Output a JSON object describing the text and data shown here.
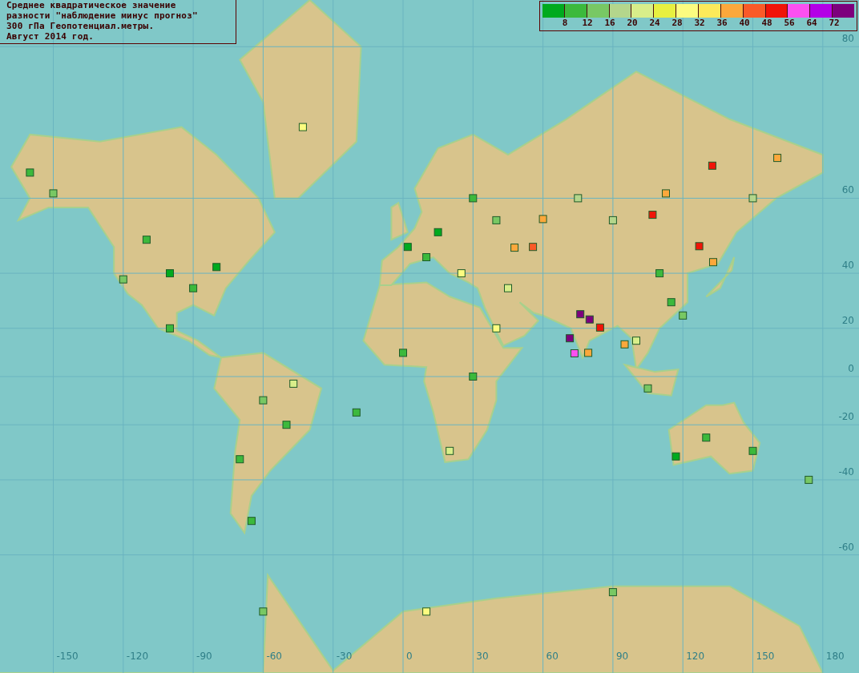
{
  "title_lines": [
    "Среднее квадратическое значение",
    "разности \"наблюдение минус прогноз\"",
    "300 гПа Геопотенциал.метры.",
    "Август 2014 год."
  ],
  "legend": {
    "swatches": [
      {
        "color": "#00aa1e"
      },
      {
        "color": "#3cb93c"
      },
      {
        "color": "#78c864"
      },
      {
        "color": "#b4d68c"
      },
      {
        "color": "#d8ee8a"
      },
      {
        "color": "#e8f040"
      },
      {
        "color": "#fcfc80"
      },
      {
        "color": "#fcea5a"
      },
      {
        "color": "#fca83c"
      },
      {
        "color": "#fa5a28"
      },
      {
        "color": "#f01408"
      },
      {
        "color": "#fc50f0"
      },
      {
        "color": "#b400e6"
      },
      {
        "color": "#7d007d"
      }
    ],
    "labels": [
      "8",
      "12",
      "16",
      "20",
      "24",
      "28",
      "32",
      "36",
      "40",
      "48",
      "56",
      "64",
      "72"
    ]
  },
  "lon_labels": [
    "-150",
    "-120",
    "-90",
    "-60",
    "-30",
    "0",
    "30",
    "60",
    "90",
    "120",
    "150",
    "180"
  ],
  "lat_labels": [
    "80",
    "60",
    "40",
    "20",
    "0",
    "-20",
    "-40",
    "-60"
  ],
  "stations": [
    {
      "color": "#f01408"
    },
    {
      "color": "#f01408"
    },
    {
      "color": "#f01408"
    },
    {
      "color": "#f01408"
    },
    {
      "color": "#7d007d"
    },
    {
      "color": "#7d007d"
    },
    {
      "color": "#7d007d"
    },
    {
      "color": "#fc50f0"
    },
    {
      "color": "#fca83c"
    },
    {
      "color": "#fa5a28"
    },
    {
      "color": "#fca83c"
    },
    {
      "color": "#fca83c"
    },
    {
      "color": "#fca83c"
    },
    {
      "color": "#fca83c"
    },
    {
      "color": "#fca83c"
    },
    {
      "color": "#fca83c"
    },
    {
      "color": "#fcfc80"
    },
    {
      "color": "#00aa1e"
    },
    {
      "color": "#3cb93c"
    },
    {
      "color": "#00aa1e"
    },
    {
      "color": "#3cb93c"
    },
    {
      "color": "#78c864"
    },
    {
      "color": "#78c864"
    },
    {
      "color": "#3cb93c"
    },
    {
      "color": "#3cb93c"
    },
    {
      "color": "#78c864"
    },
    {
      "color": "#3cb93c"
    },
    {
      "color": "#3cb93c"
    },
    {
      "color": "#3cb93c"
    },
    {
      "color": "#d8ee8a"
    },
    {
      "color": "#00aa1e"
    },
    {
      "color": "#00aa1e"
    },
    {
      "color": "#3cb93c"
    },
    {
      "color": "#78c864"
    },
    {
      "color": "#3cb93c"
    },
    {
      "color": "#fcfc80"
    },
    {
      "color": "#d8ee8a"
    },
    {
      "color": "#b4d68c"
    },
    {
      "color": "#b4d68c"
    },
    {
      "color": "#3cb93c"
    },
    {
      "color": "#3cb93c"
    },
    {
      "color": "#78c864"
    },
    {
      "color": "#d8ee8a"
    },
    {
      "color": "#78c864"
    },
    {
      "color": "#3cb93c"
    },
    {
      "color": "#3cb93c"
    },
    {
      "color": "#d8ee8a"
    },
    {
      "color": "#fcfc80"
    },
    {
      "color": "#3cb93c"
    },
    {
      "color": "#3cb93c"
    },
    {
      "color": "#00aa1e"
    },
    {
      "color": "#78c864"
    },
    {
      "color": "#b4d68c"
    },
    {
      "color": "#3cb93c"
    },
    {
      "color": "#78c864"
    },
    {
      "color": "#fcfc80"
    },
    {
      "color": "#78c864"
    }
  ]
}
